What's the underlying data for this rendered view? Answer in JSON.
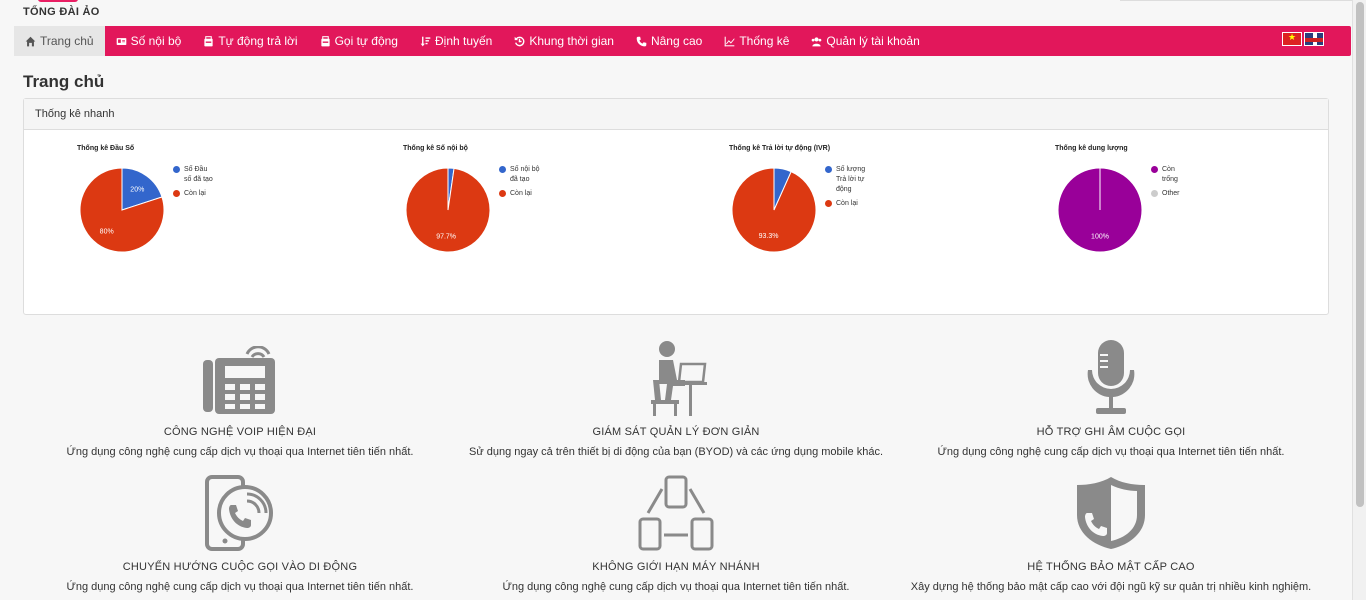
{
  "brand": {
    "logo_text": "TỔNG ĐÀI ẢO",
    "accent": "#e2175b"
  },
  "nav": {
    "items": [
      {
        "label": "Trang chủ",
        "icon": "home-icon",
        "active": true
      },
      {
        "label": "Số nội bộ",
        "icon": "id-card-icon"
      },
      {
        "label": "Tự động trả lời",
        "icon": "fax-icon"
      },
      {
        "label": "Gọi tự động",
        "icon": "fax-icon"
      },
      {
        "label": "Định tuyến",
        "icon": "sort-icon"
      },
      {
        "label": "Khung thời gian",
        "icon": "history-icon"
      },
      {
        "label": "Nâng cao",
        "icon": "phone-icon"
      },
      {
        "label": "Thống kê",
        "icon": "line-chart-icon"
      },
      {
        "label": "Quản lý tài khoản",
        "icon": "users-icon"
      }
    ],
    "flags": [
      "flag-vn-icon",
      "flag-en-icon"
    ]
  },
  "page_title": "Trang chủ",
  "panel": {
    "heading": "Thống kê nhanh"
  },
  "charts": [
    {
      "title": "Thống kê Đầu Số",
      "slices": [
        {
          "label": "Số Đầu số đã tạo",
          "value": 20,
          "display": "20%",
          "color": "#3366cc"
        },
        {
          "label": "Còn lại",
          "value": 80,
          "display": "80%",
          "color": "#dc3912"
        }
      ]
    },
    {
      "title": "Thống kê Số nội bộ",
      "slices": [
        {
          "label": "Số nội bộ đã tạo",
          "value": 2.3,
          "display": "",
          "color": "#3366cc"
        },
        {
          "label": "Còn lại",
          "value": 97.7,
          "display": "97.7%",
          "color": "#dc3912"
        }
      ]
    },
    {
      "title": "Thống kê Trả lời tự động (IVR)",
      "slices": [
        {
          "label": "Số lượng Trả lời tự động",
          "value": 6.7,
          "display": "",
          "color": "#3366cc"
        },
        {
          "label": "Còn lại",
          "value": 93.3,
          "display": "93.3%",
          "color": "#dc3912"
        }
      ]
    },
    {
      "title": "Thống kê dung lượng",
      "slices": [
        {
          "label": "Còn trống",
          "value": 100,
          "display": "100%",
          "color": "#990099"
        },
        {
          "label": "Other",
          "value": 0,
          "display": "",
          "color": "#cccccc"
        }
      ]
    }
  ],
  "features": [
    {
      "title": "CÔNG NGHỆ VOIP HIỆN ĐẠI",
      "desc": "Ứng dụng công nghệ cung cấp dịch vụ thoại qua Internet tiên tiến nhất.",
      "icon": "voip-phone-icon"
    },
    {
      "title": "GIÁM SÁT QUẢN LÝ ĐƠN GIẢN",
      "desc": "Sử dụng ngay cả trên thiết bị di động của bạn (BYOD) và các ứng dụng mobile khác.",
      "icon": "user-laptop-icon"
    },
    {
      "title": "HỖ TRỢ GHI ÂM CUỘC GỌI",
      "desc": "Ứng dụng công nghệ cung cấp dịch vụ thoại qua Internet tiên tiến nhất.",
      "icon": "microphone-icon"
    },
    {
      "title": "CHUYỂN HƯỚNG CUỘC GỌI VÀO DI ĐỘNG",
      "desc": "Ứng dụng công nghệ cung cấp dịch vụ thoại qua Internet tiên tiến nhất.",
      "icon": "mobile-call-icon"
    },
    {
      "title": "KHÔNG GIỚI HẠN MÁY NHÁNH",
      "desc": "Ứng dụng công nghệ cung cấp dịch vụ thoại qua Internet tiên tiến nhất.",
      "icon": "devices-network-icon"
    },
    {
      "title": "HỆ THỐNG BẢO MẬT CẤP CAO",
      "desc": "Xây dựng hệ thống bảo mật cấp cao với đội ngũ kỹ sư quản trị nhiều kinh nghiệm.",
      "icon": "security-shield-icon"
    }
  ]
}
